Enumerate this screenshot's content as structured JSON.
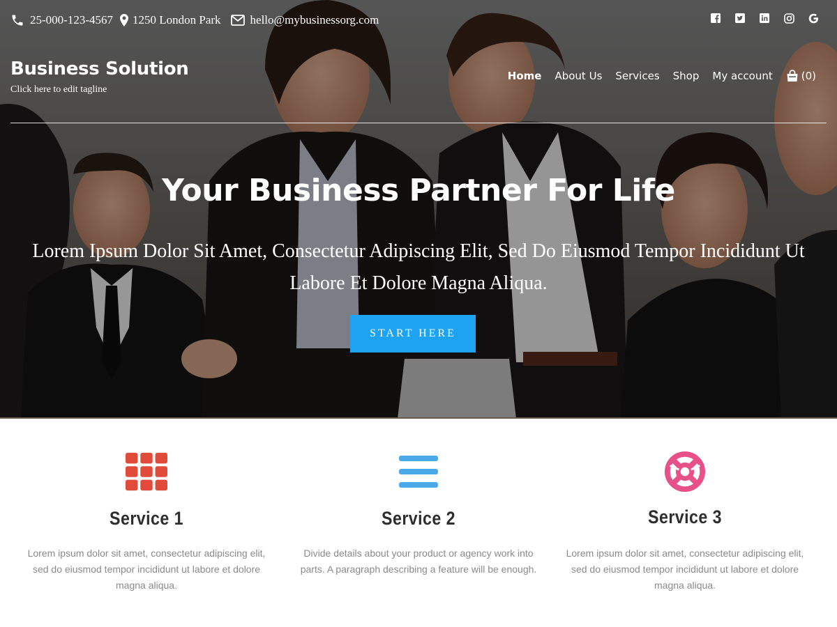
{
  "topbar": {
    "phone": "25-000-123-4567",
    "address": "1250 London Park",
    "email": "hello@mybusinessorg.com",
    "phone_icon": "phone-icon",
    "address_icon": "map-marker-icon",
    "email_icon": "envelope-icon"
  },
  "social": [
    "facebook-icon",
    "twitter-icon",
    "linkedin-icon",
    "instagram-icon",
    "google-icon"
  ],
  "brand": {
    "title": "Business Solution",
    "tagline": "Click here to edit tagline"
  },
  "nav": {
    "items": [
      {
        "label": "Home",
        "active": true
      },
      {
        "label": "About Us"
      },
      {
        "label": "Services"
      },
      {
        "label": "Shop"
      },
      {
        "label": "My account"
      }
    ],
    "cart_count": "(0)",
    "cart_icon": "shopping-bag-icon"
  },
  "hero": {
    "title": "Your Business Partner For Life",
    "subtitle": "Lorem Ipsum Dolor Sit Amet, Consectetur Adipiscing Elit, Sed Do Eiusmod Tempor Incididunt Ut Labore Et Dolore Magna Aliqua.",
    "cta_label": "START HERE"
  },
  "services": [
    {
      "title": "Service 1",
      "icon": "grid-icon",
      "icon_color": "#e04b3a",
      "description": "Lorem ipsum dolor sit amet, consectetur adipiscing elit, sed do eiusmod tempor incididunt ut labore et dolore magna aliqua."
    },
    {
      "title": "Service 2",
      "icon": "menu-bars-icon",
      "icon_color": "#4aa9ea",
      "description": "Divide details about your product or agency work into parts. A paragraph describing a feature will be enough."
    },
    {
      "title": "Service 3",
      "icon": "life-ring-icon",
      "icon_color": "#e8508a",
      "description": "Lorem ipsum dolor sit amet, consectetur adipiscing elit, sed do eiusmod tempor incididunt ut labore et dolore magna aliqua."
    }
  ],
  "colors": {
    "accent": "#1ea3f2",
    "heading": "#2e2e2e",
    "body_text": "#8a8a8a"
  }
}
